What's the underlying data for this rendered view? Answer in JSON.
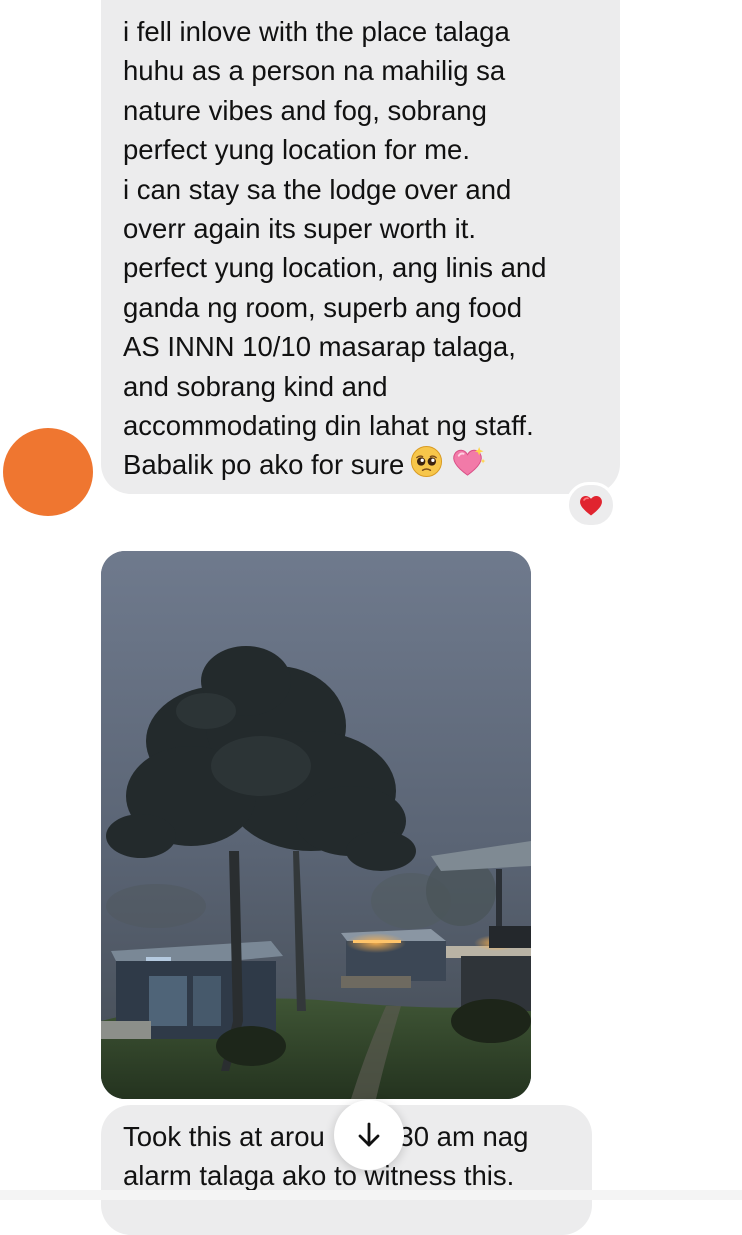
{
  "conversation": {
    "first_message": {
      "lines": [
        "i fell inlove with the place talaga",
        "huhu as a person na mahilig sa",
        "nature vibes and fog, sobrang",
        "perfect yung location for me.",
        "i can stay sa the lodge over and",
        "overr again its super worth it.",
        "perfect yung location, ang linis and",
        "ganda ng room, superb ang food",
        "AS INNN 10/10 masarap talaga,",
        "and sobrang kind and",
        "accommodating din lahat ng staff.",
        "Babalik po ako for sure"
      ],
      "trailing_emojis": [
        "pleading-face",
        "sparkling-heart"
      ],
      "reaction": "heart"
    },
    "photo": {
      "subject": "foggy-lodge-at-dawn"
    },
    "second_message": {
      "line_1_start": "Took this at arou",
      "line_1_end": ":30 am nag",
      "line_2": "alarm talaga ako to witness this."
    }
  },
  "sender": {
    "avatar_color": "#ef7630"
  },
  "controls": {
    "scroll_down": "arrow-down-icon"
  },
  "colors": {
    "bubble": "#ececed",
    "text": "#111111",
    "reaction_heart": "#e0242f"
  }
}
